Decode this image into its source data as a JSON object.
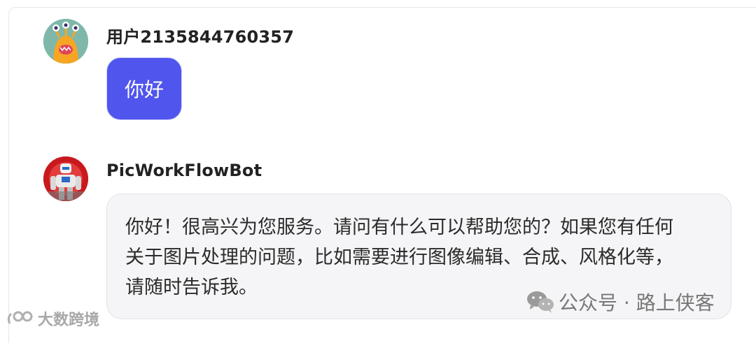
{
  "messages": {
    "user": {
      "name": "用户2135844760357",
      "text": "你好",
      "avatar_icon": "monster-avatar-icon",
      "bubble_color": "#5055ee"
    },
    "bot": {
      "name": "PicWorkFlowBot",
      "avatar_icon": "robot-avatar-icon",
      "lines": [
        "你好！很高兴为您服务。请问有什么可以帮助您的？如果您有任何",
        "关于图片处理的问题，比如需要进行图像编辑、合成、风格化等，",
        "请随时告诉我。"
      ]
    }
  },
  "watermarks": {
    "wechat": "公众号 · 路上侠客",
    "wechat_icon": "wechat-icon",
    "brand": "大数跨境",
    "brand_icon": "brand-logo-icon"
  }
}
